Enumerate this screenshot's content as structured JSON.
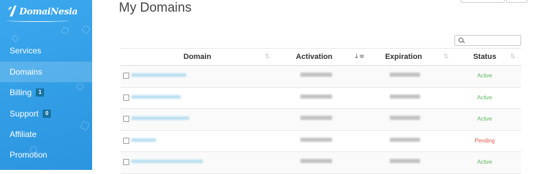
{
  "brand": {
    "name": "DomaiNesia"
  },
  "sidebar": {
    "items": [
      {
        "label": "Services",
        "badge": null
      },
      {
        "label": "Domains",
        "badge": null,
        "active": true
      },
      {
        "label": "Billing",
        "badge": "1"
      },
      {
        "label": "Support",
        "badge": "0"
      },
      {
        "label": "Affiliate",
        "badge": null
      },
      {
        "label": "Promotion",
        "badge": null
      }
    ]
  },
  "page": {
    "title": "My Domains"
  },
  "search": {
    "placeholder": ""
  },
  "table": {
    "columns": [
      "Domain",
      "Activation",
      "Expiration",
      "Status"
    ],
    "rows": [
      {
        "status": "Active"
      },
      {
        "status": "Active"
      },
      {
        "status": "Active"
      },
      {
        "status": "Pending"
      },
      {
        "status": "Active"
      }
    ]
  },
  "colors": {
    "sidebar_bg": "#2f9fe6",
    "badge_bg": "#18729f",
    "status_active": "#5cb85c",
    "status_pending": "#e2574c"
  },
  "icons": {
    "sort_unsorted": "sort-icon",
    "sort_asc": "sort-amount-icon",
    "search": "search-icon"
  }
}
